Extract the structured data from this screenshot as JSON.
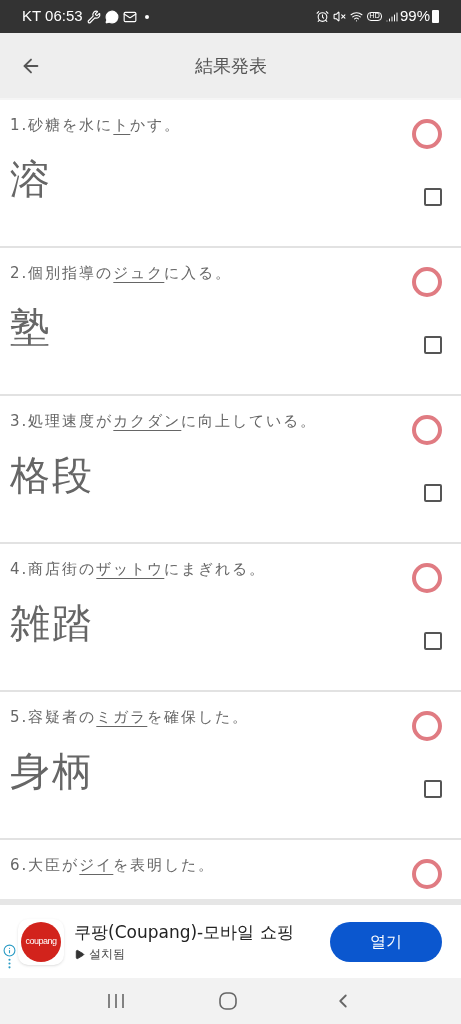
{
  "status_bar": {
    "carrier_time": "KT 06:53",
    "battery": "99%",
    "hd": "HD"
  },
  "header": {
    "title": "結果発表"
  },
  "questions": [
    {
      "number": "1.",
      "before": "砂糖を水に",
      "target": "ト",
      "after": "かす。",
      "answer": "溶",
      "correct": true,
      "checked": false
    },
    {
      "number": "2.",
      "before": "個別指導の",
      "target": "ジュク",
      "after": "に入る。",
      "answer": "塾",
      "correct": true,
      "checked": false
    },
    {
      "number": "3.",
      "before": "処理速度が",
      "target": "カクダン",
      "after": "に向上している。",
      "answer": "格段",
      "correct": true,
      "checked": false
    },
    {
      "number": "4.",
      "before": "商店街の",
      "target": "ザットウ",
      "after": "にまぎれる。",
      "answer": "雑踏",
      "correct": true,
      "checked": false
    },
    {
      "number": "5.",
      "before": "容疑者の",
      "target": "ミガラ",
      "after": "を確保した。",
      "answer": "身柄",
      "correct": true,
      "checked": false
    },
    {
      "number": "6.",
      "before": "大臣が",
      "target": "ジイ",
      "after": "を表明した。",
      "correct": true
    }
  ],
  "ad": {
    "logo_text": "coupang",
    "title": "쿠팡(Coupang)-모바일 쇼핑",
    "status": "설치됨",
    "button": "열기"
  }
}
